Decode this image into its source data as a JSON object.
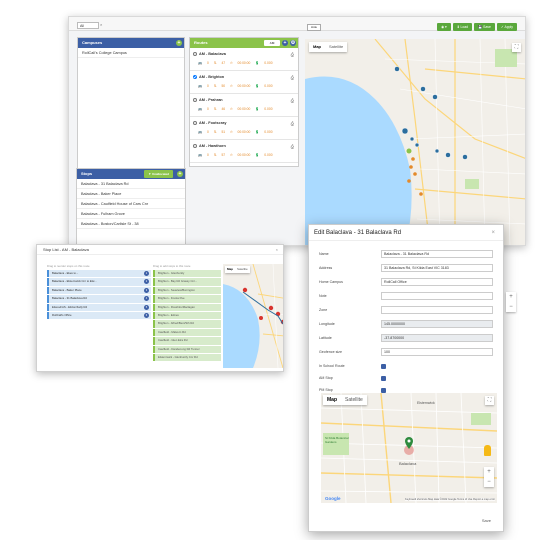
{
  "main": {
    "tab_select": "All",
    "tab_close": "×",
    "hide_label": "Hide",
    "toolbar": {
      "view_label": "◉ ▾",
      "load_label": "⬇ Load",
      "save_label": "💾 Save",
      "apply_label": "✓ Apply"
    },
    "campuses": {
      "title": "Campuses",
      "items": [
        "RollCall's College Campus"
      ]
    },
    "routes": {
      "title": "Routes",
      "select_label": "AM",
      "items": [
        {
          "name": "AM - Balaclava",
          "checked": false,
          "stats": "🚌 0   ⇅ 47   ⏱ 00:00:00   💲 0.000"
        },
        {
          "name": "AM - Brighton",
          "checked": true,
          "stats": "🚌 0   ⇅ 50   ⏱ 00:00:00   💲 0.000"
        },
        {
          "name": "AM - Prahran",
          "checked": false,
          "stats": "🚌 0   ⇅ 46   ⏱ 00:00:00   💲 0.000"
        },
        {
          "name": "AM - Footscray",
          "checked": false,
          "stats": "🚌 0   ⇅ 51   ⏱ 00:00:00   💲 0.000"
        },
        {
          "name": "AM - Hawthorn",
          "checked": false,
          "stats": "🚌 0   ⇅ 57   ⏱ 00:00:00   💲 0.000"
        }
      ]
    },
    "stops": {
      "title": "Stops",
      "filter_label": "▼ Unallocated",
      "items": [
        "Balaclava - 31 Balaclava Rd",
        "Balaclava - Baker Place",
        "Balaclava - Caulfield House of Cars Cnr",
        "Balaclava - Fulham Grove",
        "Balaclava - Boston/Carlisle St - 38"
      ]
    },
    "map_tabs": [
      "Map",
      "Satellite"
    ]
  },
  "small_window": {
    "title": "Stop List - AM - Balaclava",
    "left_hint": "Drag to reorder stops on this route",
    "mid_hint": "Drag to add stops to this route",
    "left_items": [
      {
        "label": "Balaclava - Ekes to...",
        "num": "1"
      },
      {
        "label": "Balaclava - Elsternwick Cnr to Elw...",
        "num": "2"
      },
      {
        "label": "Balaclava - Baker Place",
        "num": "3"
      },
      {
        "label": "Balaclava - 31 Balaclava Rd",
        "num": "4"
      },
      {
        "label": "Elwood/AS - Eildon/Kelly Rd",
        "num": "5"
      },
      {
        "label": "RollCall's Office",
        "num": "6"
      }
    ],
    "mid_items": [
      "Brighton - Glenhuntly",
      "Brighton - Bay Rd Grassy Cnr...",
      "Brighton - Seaview/Bonington",
      "Brighton - Fresta Dve",
      "Brighton - Rosshire/Maclagan",
      "Brighton - Ednes",
      "Brighton - Alfred/Bent/Sth Rd",
      "Caulfield - Malvern Rd",
      "Caulfield - Glen Eira Rd",
      "Caulfield - Dandenong Rd Tunnel",
      "Elsternwick - Glenhuntly Cnr Rd"
    ],
    "map_tabs": [
      "Map",
      "Satellite"
    ]
  },
  "modal": {
    "title": "Edit Balaclava - 31 Balaclava Rd",
    "close": "×",
    "fields": [
      {
        "label": "Name",
        "value": "Balaclava - 31 Balaclava Rd",
        "disabled": false
      },
      {
        "label": "Address",
        "value": "31 Balaclava Rd, St Kilda East VIC 3183",
        "disabled": false
      },
      {
        "label": "Home Campus",
        "value": "RollCall Office",
        "disabled": false
      },
      {
        "label": "Note",
        "value": "",
        "disabled": false
      },
      {
        "label": "Zone",
        "value": "",
        "disabled": false
      },
      {
        "label": "Longitude",
        "value": "145.0000000",
        "disabled": true
      },
      {
        "label": "Latitude",
        "value": "-37.8700000",
        "disabled": true
      },
      {
        "label": "Geofence size",
        "value": "100",
        "disabled": false
      }
    ],
    "checks": [
      {
        "label": "In School Route",
        "checked": true
      },
      {
        "label": "AM Stop",
        "checked": true
      },
      {
        "label": "PM Stop",
        "checked": true
      }
    ],
    "map_tabs": [
      "Map",
      "Satellite"
    ],
    "map_labels": [
      "Balaclava",
      "Elsternwick",
      "St Kilda Botanical Gardens"
    ],
    "footer": "Save",
    "google": "Google",
    "attribution": "Keyboard shortcuts   Map data ©2022 Google   Terms of Use   Report a map error"
  },
  "colors": {
    "primary_blue": "#3c5fa5",
    "accent_green": "#8bc34a",
    "button_green": "#5aa83c",
    "marker_red": "#d8332d",
    "marker_blue": "#2c6e9e",
    "water": "#aadaff",
    "land": "#f2efe9"
  }
}
